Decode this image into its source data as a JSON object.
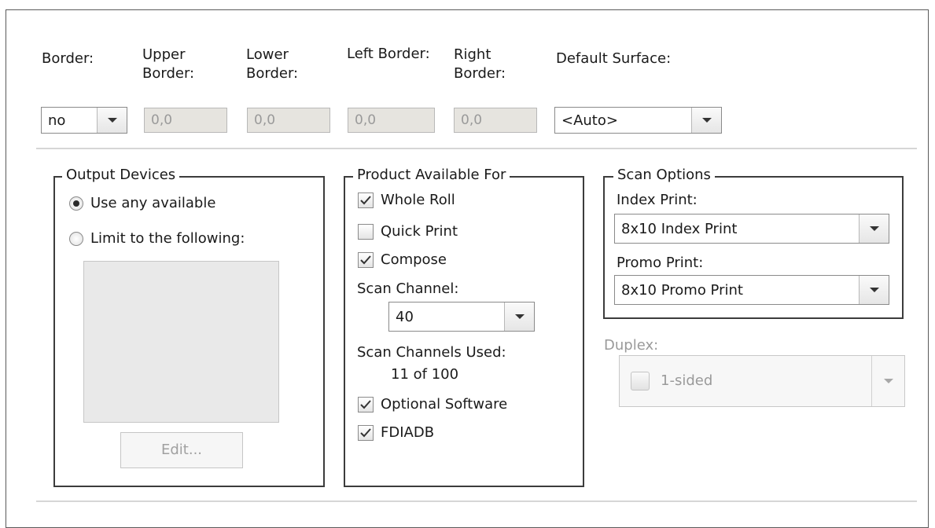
{
  "border_row": {
    "border_label": "Border:",
    "upper_label": "Upper\nBorder:",
    "lower_label": "Lower\nBorder:",
    "left_label": "Left Border:",
    "right_label": "Right\nBorder:",
    "surface_label": "Default Surface:",
    "border_value": "no",
    "upper_value": "0,0",
    "lower_value": "0,0",
    "left_value": "0,0",
    "right_value": "0,0",
    "surface_value": "<Auto>"
  },
  "output_devices": {
    "title": "Output Devices",
    "option_any": "Use any available",
    "option_limit": "Limit to the following:",
    "selected": "any",
    "edit_button": "Edit..."
  },
  "product": {
    "title": "Product Available For",
    "whole_roll": {
      "label": "Whole Roll",
      "checked": true
    },
    "quick_print": {
      "label": "Quick Print",
      "checked": false
    },
    "compose": {
      "label": "Compose",
      "checked": true
    },
    "scan_channel_label": "Scan Channel:",
    "scan_channel_value": "40",
    "channels_used_label": "Scan Channels Used:",
    "channels_used_value": "11 of 100",
    "optional_software": {
      "label": "Optional Software",
      "checked": true
    },
    "fdiadb": {
      "label": "FDIADB",
      "checked": true
    }
  },
  "scan_options": {
    "title": "Scan Options",
    "index_label": "Index Print:",
    "index_value": "8x10 Index Print",
    "promo_label": "Promo Print:",
    "promo_value": "8x10 Promo Print"
  },
  "duplex": {
    "label": "Duplex:",
    "value": "1-sided"
  },
  "icons": {
    "dropdown": "chevron-down-icon",
    "check": "checkmark-icon",
    "radio": "radio-dot-icon",
    "duplex": "sided-page-icon"
  },
  "colors": {
    "text": "#1a1a1a",
    "disabled_text": "#9a9a9a",
    "disabled_field": "#e6e4df",
    "group_border": "#3c3c3c"
  }
}
